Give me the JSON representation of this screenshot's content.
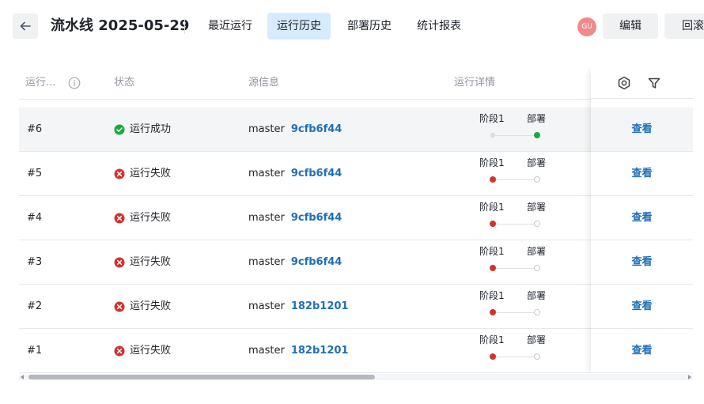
{
  "header": {
    "title": "流水线 2025-05-29",
    "tabs": [
      {
        "label": "最近运行",
        "active": false
      },
      {
        "label": "运行历史",
        "active": true
      },
      {
        "label": "部署历史",
        "active": false
      },
      {
        "label": "统计报表",
        "active": false
      }
    ],
    "avatar_text": "GU",
    "edit_label": "编辑",
    "rollback_label": "回滚"
  },
  "table": {
    "columns": {
      "run": "运行...",
      "status": "状态",
      "source": "源信息",
      "detail": "运行详情"
    },
    "stage_names": [
      "阶段1",
      "部署"
    ],
    "action_label": "查看",
    "rows": [
      {
        "num": "#6",
        "status": "运行成功",
        "state": "success",
        "branch": "master",
        "commit": "9cfb6f44"
      },
      {
        "num": "#5",
        "status": "运行失败",
        "state": "failed",
        "branch": "master",
        "commit": "9cfb6f44"
      },
      {
        "num": "#4",
        "status": "运行失败",
        "state": "failed",
        "branch": "master",
        "commit": "9cfb6f44"
      },
      {
        "num": "#3",
        "status": "运行失败",
        "state": "failed",
        "branch": "master",
        "commit": "9cfb6f44"
      },
      {
        "num": "#2",
        "status": "运行失败",
        "state": "failed",
        "branch": "master",
        "commit": "182b1201"
      },
      {
        "num": "#1",
        "status": "运行失败",
        "state": "failed",
        "branch": "master",
        "commit": "182b1201"
      }
    ]
  },
  "colors": {
    "success": "#1aaa3c",
    "failed": "#d1332e",
    "link": "#1f6fb8",
    "active_tab": "#d6ebfd"
  },
  "icons": {
    "back": "arrow-left-icon",
    "info": "info-circle-icon",
    "settings": "settings-hexagon-icon",
    "filter": "filter-funnel-icon"
  }
}
